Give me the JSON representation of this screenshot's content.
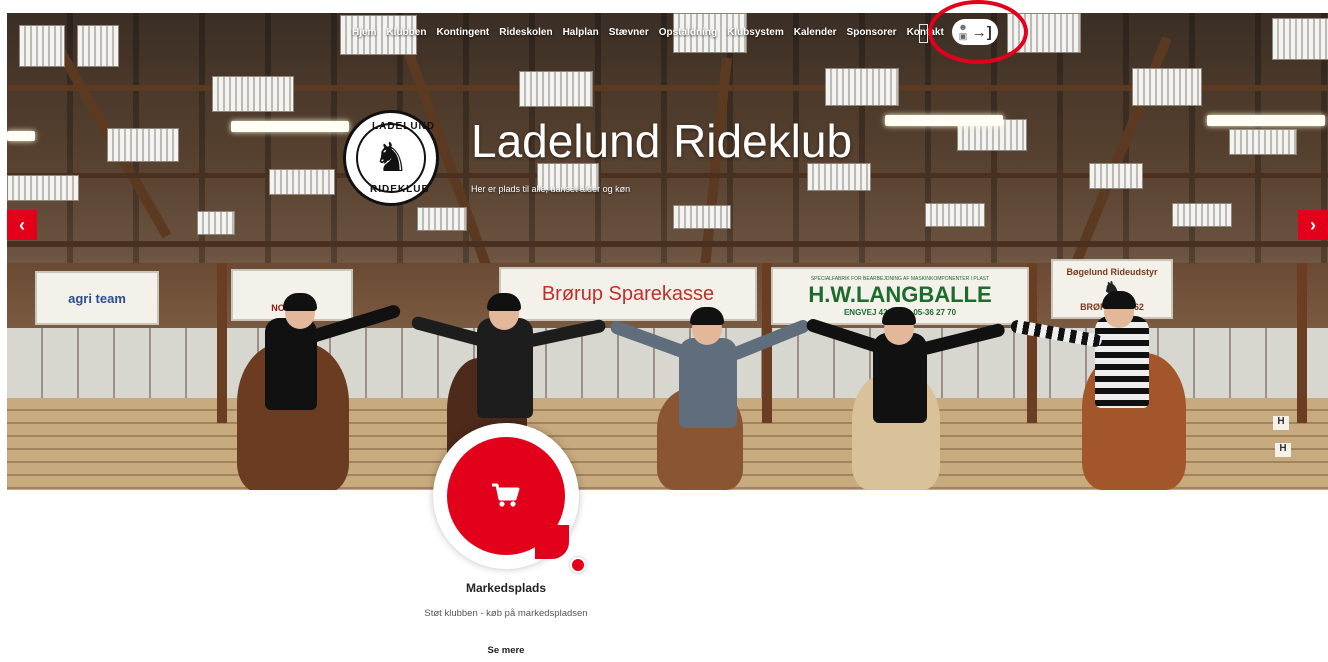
{
  "nav": {
    "items": [
      "Hjem",
      "Klubben",
      "Kontingent",
      "Rideskolen",
      "Halplan",
      "Stævner",
      "Opstaldning",
      "Klubsystem",
      "Kalender",
      "Sponsorer",
      "Kontakt"
    ],
    "login_icon": "user-lock-icon",
    "login_arrow": "→]"
  },
  "hero": {
    "logo_top": "LADELUND",
    "logo_bottom": "RIDEKLUB",
    "title": "Ladelund Rideklub",
    "subtitle": "Her er plads til alle, uanset alder og køn",
    "prev_label": "‹",
    "next_label": "›",
    "banners": {
      "team": "agri team",
      "nordisk": "NORDISK",
      "bank": "Brørup Sparekasse",
      "langballe": "H.W.LANGBALLE",
      "langballe_sub": "SPECIALFABRIK FOR BEARBEJDNING AF MASKINKOMPONENTER I PLAST",
      "langballe_addr": "ENGVEJ 43  TELF. 05-36 27 70",
      "saddlery": "Bøgelund Rideudstyr",
      "saddlery_sub": "BRØRUP 93 62"
    },
    "arena_letters": [
      "H",
      "H"
    ]
  },
  "colors": {
    "accent": "#e3001b"
  },
  "marketplace": {
    "icon": "shopping-cart-icon",
    "title": "Markedsplads",
    "description": "Støt klubben - køb på markedspladsen",
    "more": "Se mere"
  }
}
